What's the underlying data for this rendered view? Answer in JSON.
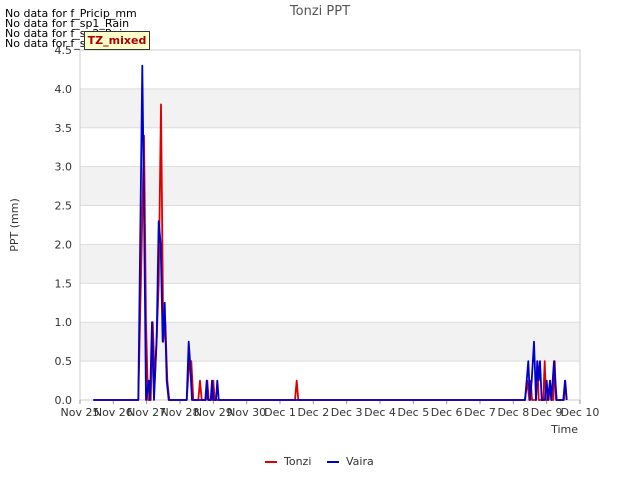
{
  "no_data_messages": [
    "No data for f_Pricip_mm",
    "No data for f_sp1_Rain",
    "No data for f_sp2_Rain",
    "No data for f_sp3_Rain"
  ],
  "badge": "TZ_mixed",
  "chart_data": {
    "type": "line",
    "title": "Tonzi PPT",
    "xlabel": "Time",
    "ylabel": "PPT (mm)",
    "ylim": [
      0,
      4.5
    ],
    "xlim": [
      "Nov 25",
      "Dec 10"
    ],
    "x_ticks": [
      "Nov 25",
      "Nov 26",
      "Nov 27",
      "Nov 28",
      "Nov 29",
      "Nov 30",
      "Dec 1",
      "Dec 2",
      "Dec 3",
      "Dec 4",
      "Dec 5",
      "Dec 6",
      "Dec 7",
      "Dec 8",
      "Dec 9",
      "Dec 10"
    ],
    "y_ticks": [
      "0.0",
      "0.5",
      "1.0",
      "1.5",
      "2.0",
      "2.5",
      "3.0",
      "3.5",
      "4.0",
      "4.5"
    ],
    "grid": true,
    "legend": "bottom-center",
    "series": [
      {
        "name": "Tonzi",
        "color": "#dd0000",
        "points": [
          [
            25.4,
            0
          ],
          [
            26.75,
            0
          ],
          [
            26.85,
            2.0
          ],
          [
            26.92,
            3.4
          ],
          [
            26.98,
            1.0
          ],
          [
            27.04,
            0
          ],
          [
            27.12,
            0
          ],
          [
            27.18,
            1.0
          ],
          [
            27.24,
            0.25
          ],
          [
            27.3,
            0.8
          ],
          [
            27.36,
            1.5
          ],
          [
            27.43,
            3.8
          ],
          [
            27.5,
            0.75
          ],
          [
            27.56,
            1.0
          ],
          [
            27.62,
            0.25
          ],
          [
            27.68,
            0
          ],
          [
            28.2,
            0
          ],
          [
            28.28,
            0.5
          ],
          [
            28.34,
            0.5
          ],
          [
            28.4,
            0
          ],
          [
            28.55,
            0
          ],
          [
            28.6,
            0.25
          ],
          [
            28.65,
            0
          ],
          [
            28.78,
            0
          ],
          [
            28.82,
            0.25
          ],
          [
            28.86,
            0
          ],
          [
            28.97,
            0
          ],
          [
            29.0,
            0.25
          ],
          [
            29.04,
            0
          ],
          [
            31.45,
            0
          ],
          [
            31.5,
            0.25
          ],
          [
            31.55,
            0
          ],
          [
            38.35,
            0
          ],
          [
            38.42,
            0.25
          ],
          [
            38.48,
            0
          ],
          [
            38.52,
            0.25
          ],
          [
            38.56,
            0
          ],
          [
            38.68,
            0
          ],
          [
            38.72,
            0.5
          ],
          [
            38.76,
            0
          ],
          [
            38.9,
            0
          ],
          [
            38.94,
            0.5
          ],
          [
            38.98,
            0
          ],
          [
            39.06,
            0
          ],
          [
            39.1,
            0.25
          ],
          [
            39.14,
            0
          ],
          [
            39.2,
            0
          ],
          [
            39.24,
            0.5
          ],
          [
            39.28,
            0
          ],
          [
            39.52,
            0
          ],
          [
            39.56,
            0.25
          ],
          [
            39.6,
            0
          ]
        ]
      },
      {
        "name": "Vaira",
        "color": "#0000cc",
        "points": [
          [
            25.4,
            0
          ],
          [
            26.75,
            0
          ],
          [
            26.87,
            4.3
          ],
          [
            26.92,
            2.5
          ],
          [
            26.98,
            0
          ],
          [
            27.06,
            0.25
          ],
          [
            27.1,
            0
          ],
          [
            27.16,
            1.0
          ],
          [
            27.22,
            0
          ],
          [
            27.3,
            0.8
          ],
          [
            27.36,
            2.3
          ],
          [
            27.42,
            2.0
          ],
          [
            27.48,
            0.75
          ],
          [
            27.54,
            1.25
          ],
          [
            27.6,
            0.25
          ],
          [
            27.66,
            0
          ],
          [
            28.2,
            0
          ],
          [
            28.26,
            0.75
          ],
          [
            28.3,
            0.5
          ],
          [
            28.36,
            0
          ],
          [
            28.76,
            0
          ],
          [
            28.8,
            0.25
          ],
          [
            28.84,
            0
          ],
          [
            28.92,
            0
          ],
          [
            28.96,
            0.25
          ],
          [
            29.0,
            0
          ],
          [
            29.08,
            0
          ],
          [
            29.12,
            0.25
          ],
          [
            29.16,
            0
          ],
          [
            38.35,
            0
          ],
          [
            38.4,
            0.25
          ],
          [
            38.45,
            0.5
          ],
          [
            38.5,
            0
          ],
          [
            38.55,
            0.25
          ],
          [
            38.62,
            0.75
          ],
          [
            38.68,
            0
          ],
          [
            38.72,
            0.5
          ],
          [
            38.76,
            0.25
          ],
          [
            38.8,
            0.5
          ],
          [
            38.85,
            0
          ],
          [
            38.95,
            0
          ],
          [
            39.0,
            0.25
          ],
          [
            39.04,
            0
          ],
          [
            39.1,
            0.25
          ],
          [
            39.14,
            0
          ],
          [
            39.18,
            0.25
          ],
          [
            39.22,
            0.5
          ],
          [
            39.26,
            0.25
          ],
          [
            39.3,
            0
          ],
          [
            39.5,
            0
          ],
          [
            39.55,
            0.25
          ],
          [
            39.6,
            0
          ]
        ]
      }
    ]
  }
}
